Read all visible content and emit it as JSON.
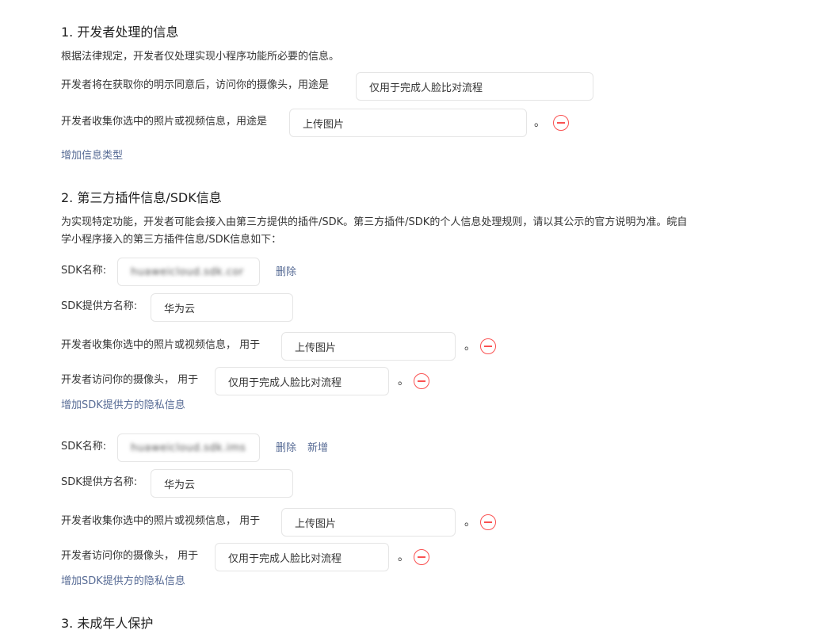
{
  "section1": {
    "title": "1. 开发者处理的信息",
    "desc": "根据法律规定，开发者仅处理实现小程序功能所必要的信息。",
    "camera_label": "开发者将在获取你的明示同意后，访问你的摄像头，用途是",
    "camera_value": "仅用于完成人脸比对流程",
    "photo_label": "开发者收集你选中的照片或视频信息，用途是",
    "photo_value": "上传图片",
    "period": "。",
    "add_info_type": "增加信息类型"
  },
  "section2": {
    "title": "2. 第三方插件信息/SDK信息",
    "desc": "为实现特定功能，开发者可能会接入由第三方提供的插件/SDK。第三方插件/SDK的个人信息处理规则，请以其公示的官方说明为准。皖自学小程序接入的第三方插件信息/SDK信息如下：",
    "sdks": [
      {
        "name_label": "SDK名称:",
        "name_value": "huaweicloud.sdk.cor",
        "delete_label": "删除",
        "provider_label": "SDK提供方名称:",
        "provider_value": "华为云",
        "photo_label": "开发者收集你选中的照片或视频信息， 用于",
        "photo_value": "上传图片",
        "camera_label": "开发者访问你的摄像头， 用于",
        "camera_value": "仅用于完成人脸比对流程",
        "period": "。",
        "add_privacy": "增加SDK提供方的隐私信息"
      },
      {
        "name_label": "SDK名称:",
        "name_value": "huaweicloud.sdk.ims",
        "delete_label": "删除",
        "add_label": "新增",
        "provider_label": "SDK提供方名称:",
        "provider_value": "华为云",
        "photo_label": "开发者收集你选中的照片或视频信息， 用于",
        "photo_value": "上传图片",
        "camera_label": "开发者访问你的摄像头， 用于",
        "camera_value": "仅用于完成人脸比对流程",
        "period": "。",
        "add_privacy": "增加SDK提供方的隐私信息"
      }
    ]
  },
  "section3": {
    "title": "3. 未成年人保护"
  },
  "colors": {
    "link": "#576b95",
    "danger": "#fa5151",
    "border": "#e5e5e5"
  }
}
